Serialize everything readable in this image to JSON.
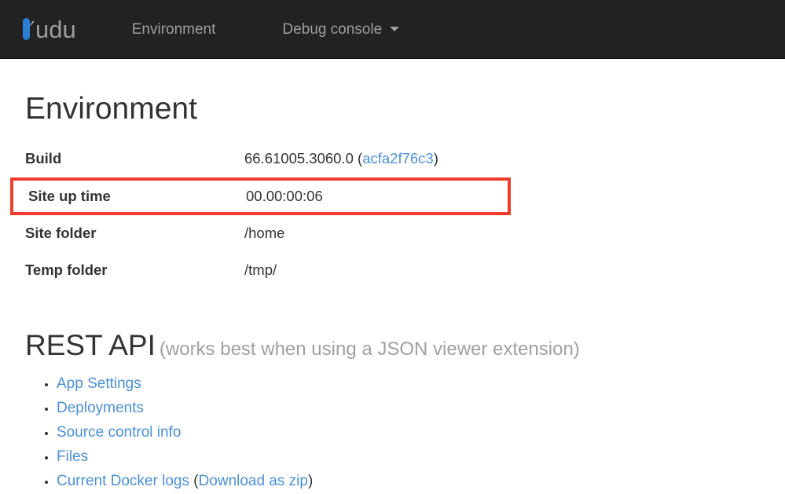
{
  "navbar": {
    "brand": {
      "text": "udu",
      "logo_icon": "kudu-logo-icon",
      "logo_color": "#2a7fd4"
    },
    "items": [
      {
        "label": "Environment",
        "icon": null
      },
      {
        "label": "Debug console",
        "icon": "chevron-down-icon"
      }
    ]
  },
  "main": {
    "page_title": "Environment",
    "env_rows": [
      {
        "key": "Build",
        "value_prefix": "66.61005.3060.0 (",
        "value_link": "acfa2f76c3",
        "value_suffix": ")",
        "highlighted": false
      },
      {
        "key": "Site up time",
        "value": "00.00:00:06",
        "highlighted": true
      },
      {
        "key": "Site folder",
        "value": "/home",
        "highlighted": false
      },
      {
        "key": "Temp folder",
        "value": "/tmp/",
        "highlighted": false
      }
    ],
    "rest_api": {
      "title": "REST API",
      "subtitle": "(works best when using a JSON viewer extension)",
      "links": [
        {
          "label": "App Settings"
        },
        {
          "label": "Deployments"
        },
        {
          "label": "Source control info"
        },
        {
          "label": "Files"
        },
        {
          "label": "Current Docker logs",
          "suffix_open": " (",
          "suffix_link": "Download as zip",
          "suffix_close": ")"
        }
      ]
    }
  },
  "annotation": {
    "highlight_color": "#ef3c2d",
    "link_color": "#4a90d9"
  }
}
